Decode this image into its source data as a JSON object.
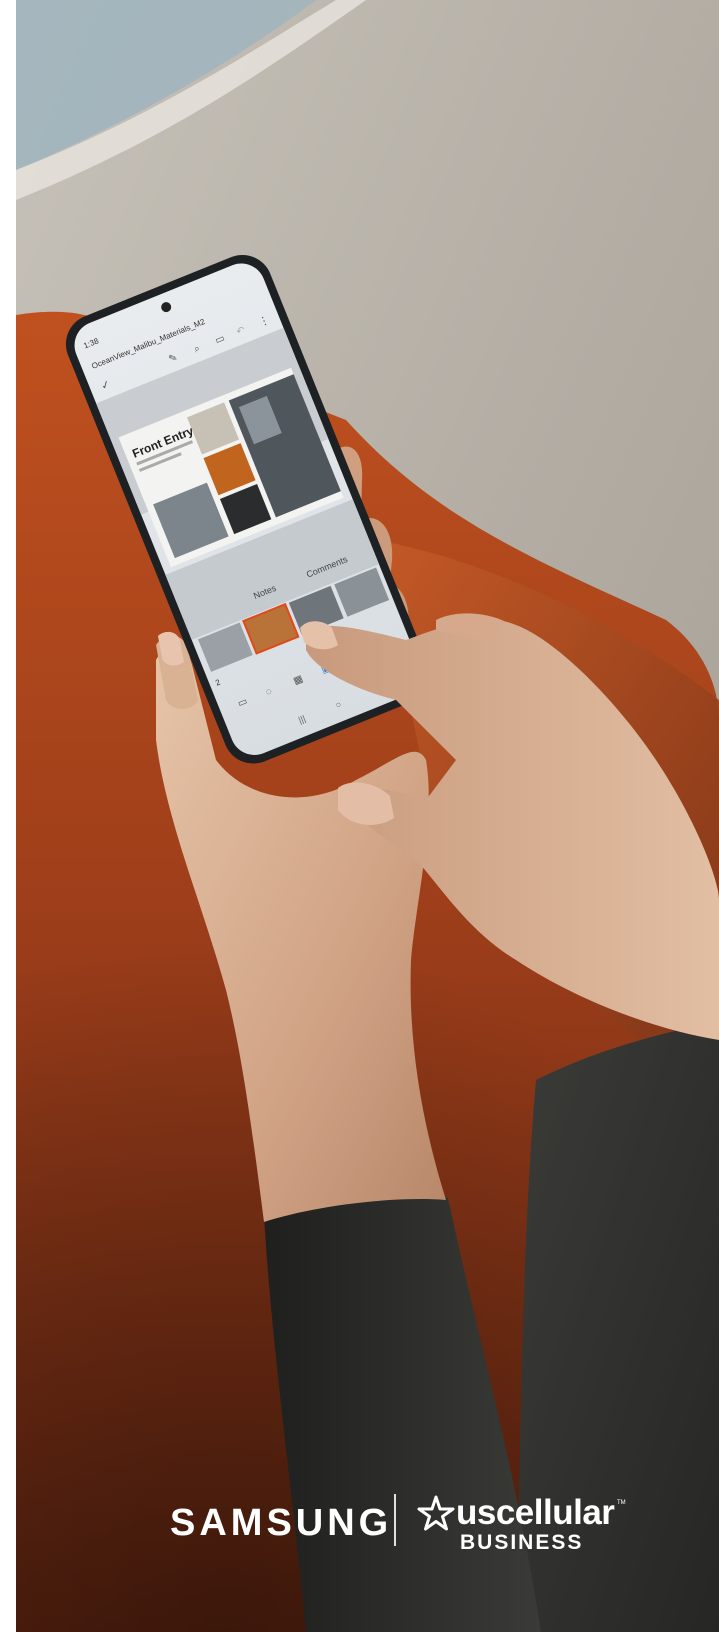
{
  "phone": {
    "status_time": "1:38",
    "file_title": "OceanView_Malibu_Materials_M2",
    "slide_heading": "Front Entry",
    "notes_label": "Notes",
    "comments_label": "Comments",
    "slide_number": "2"
  },
  "logos": {
    "samsung": "SAMSUNG",
    "uscellular": "uscellular",
    "business": "BUSINESS"
  },
  "colors": {
    "sofa_orange": "#b5451f",
    "background_gray": "#b3aca3",
    "sleeve_dark": "#2b2b29"
  }
}
